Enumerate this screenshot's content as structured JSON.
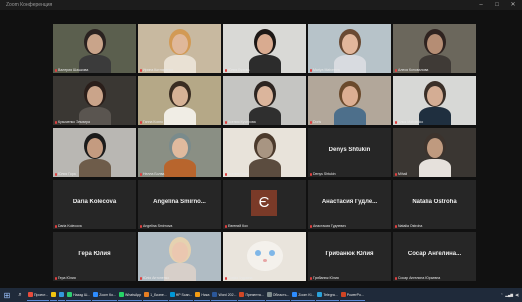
{
  "window": {
    "title": "Zoom Конференция"
  },
  "tiles": [
    {
      "name": "Валерия Шашкова",
      "type": "video",
      "active": true,
      "bg": "#5b5f4e",
      "skin": "#c9a48a",
      "hair": "#2a2220",
      "cloth": "#3b3b3b"
    },
    {
      "name": "Ирина Котляренко",
      "type": "video",
      "bg": "#c8b9a0",
      "skin": "#e0b89a",
      "hair": "#d29a55",
      "cloth": "#e9e1d4"
    },
    {
      "name": "Юлия Бузова",
      "type": "video",
      "bg": "#d9d9d6",
      "skin": "#d9ab90",
      "hair": "#1d1816",
      "cloth": "#2c2c2c"
    },
    {
      "name": "Mariya Matveeva",
      "type": "video",
      "bg": "#b7c3c9",
      "skin": "#e2b79c",
      "hair": "#6a4a33",
      "cloth": "#d8dbe0"
    },
    {
      "name": "Алеся Коновалова",
      "type": "video",
      "bg": "#6b675c",
      "skin": "#b58d74",
      "hair": "#2f2320",
      "cloth": "#3f3a36"
    },
    {
      "name": "Кузьменко Эльвира",
      "type": "video",
      "bg": "#3a3733",
      "skin": "#caa48a",
      "hair": "#2a1e1a",
      "cloth": "#5a5550"
    },
    {
      "name": "Ганна Кохно",
      "type": "video",
      "bg": "#b5a887",
      "skin": "#d6b296",
      "hair": "#3a2d22",
      "cloth": "#f0ede5"
    },
    {
      "name": "Ксения Кучерова",
      "type": "video",
      "bg": "#c5c5c2",
      "skin": "#dbb59c",
      "hair": "#2d2521",
      "cloth": "#2f2f2f"
    },
    {
      "name": "Doris",
      "type": "video",
      "bg": "#b2a79a",
      "skin": "#dcae92",
      "hair": "#6b4a2c",
      "cloth": "#4d6f8b"
    },
    {
      "name": "Илья Matvienko",
      "type": "video",
      "bg": "#d7d8d6",
      "skin": "#d4ad94",
      "hair": "#3a2f28",
      "cloth": "#1f2f3f"
    },
    {
      "name": "Юлия Гора",
      "type": "video",
      "bg": "#b9b7b3",
      "skin": "#c49b80",
      "hair": "#1b1b1b",
      "cloth": "#6e5c4a"
    },
    {
      "name": "Нелла Болва",
      "type": "video",
      "bg": "#8a8f84",
      "skin": "#e0ba9e",
      "hair": "#7a8b8c",
      "cloth": "#b8652d"
    },
    {
      "name": "Ксения Гора",
      "type": "video",
      "bg": "#e8e3da",
      "skin": "#a89582",
      "hair": "#4b3a2c",
      "cloth": "#5b4c3f"
    },
    {
      "name": "Denys Shtukin",
      "type": "name"
    },
    {
      "name": "Mihail",
      "type": "video",
      "bg": "#3a3632",
      "skin": "#bf9a7f",
      "hair": "#3c332d",
      "cloth": "#e6e1dc"
    },
    {
      "name": "Daria Koleсova",
      "type": "name"
    },
    {
      "name": "Angelina Smirno...",
      "label": "Angelina Smirnova",
      "type": "name"
    },
    {
      "name": "Евгений Кох",
      "type": "avatar",
      "letter": "Є"
    },
    {
      "name": "Анастасия Гудле...",
      "label": "Анастасия Гудлевич",
      "type": "name"
    },
    {
      "name": "Natalia Ostroha",
      "type": "name"
    },
    {
      "name": "Гера Юлия",
      "type": "name"
    },
    {
      "name": "Юлія Антоненко",
      "type": "video",
      "bg": "#b0bcc4",
      "skin": "#ebc7b0",
      "hair": "#e6d2b0",
      "cloth": "#d7cfc9"
    },
    {
      "name": "Софія Чудзина",
      "type": "cat"
    },
    {
      "name": "Грибанюк Юлия",
      "type": "name"
    },
    {
      "name": "Сосар Ангелина...",
      "label": "Сосар Ангелина Юрьевна",
      "type": "name"
    }
  ],
  "taskbar": {
    "items": [
      {
        "label": "Проект...",
        "color": "#e74c3c"
      },
      {
        "label": "",
        "color": "#f1c40f"
      },
      {
        "label": "",
        "color": "#3498db"
      },
      {
        "label": "Назад Ш...",
        "color": "#2ecc71"
      },
      {
        "label": "Zoom Ко...",
        "color": "#2d8cff"
      },
      {
        "label": "WhatsApp",
        "color": "#25d366"
      },
      {
        "label": "1_Бизне...",
        "color": "#e67e22"
      },
      {
        "label": "HP Scan...",
        "color": "#0096d6"
      },
      {
        "label": "Ника",
        "color": "#f39c12"
      },
      {
        "label": "Word 202...",
        "color": "#2b579a"
      },
      {
        "label": "Презента...",
        "color": "#d24726"
      },
      {
        "label": "Область...",
        "color": "#7f8c8d"
      },
      {
        "label": "Zoom Kl...",
        "color": "#2d8cff"
      },
      {
        "label": "Telegra...",
        "color": "#2aa1da"
      },
      {
        "label": "PowerPo...",
        "color": "#d04423"
      }
    ]
  }
}
